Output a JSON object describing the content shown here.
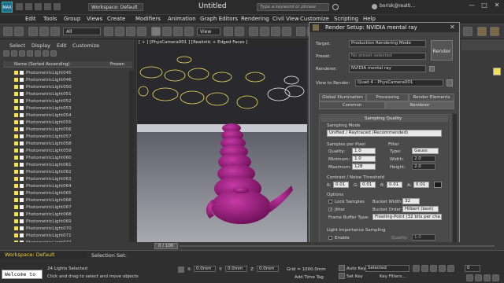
{
  "titlebar": {
    "workspace": "Workspace: Default",
    "title": "Untitled",
    "search_placeholder": "Type a keyword or phrase",
    "user": "borisk@realti..."
  },
  "menu": [
    "Edit",
    "Tools",
    "Group",
    "Views",
    "Create",
    "Modifiers",
    "Animation",
    "Graph Editors",
    "Rendering",
    "Civil View",
    "Customize",
    "Scripting",
    "Help"
  ],
  "toolbar": {
    "selection_filter": "All",
    "view_dropdown": "View"
  },
  "left_panel": {
    "tabs": [
      "Select",
      "Display",
      "Edit",
      "Customize"
    ],
    "header_name": "Name (Sorted Ascending)",
    "header_frozen": "Frozen",
    "items": [
      "PhotometricLight045",
      "PhotometricLight046",
      "PhotometricLight050",
      "PhotometricLight051",
      "PhotometricLight052",
      "PhotometricLight053",
      "PhotometricLight054",
      "PhotometricLight055",
      "PhotometricLight056",
      "PhotometricLight057",
      "PhotometricLight058",
      "PhotometricLight059",
      "PhotometricLight060",
      "PhotometricLight061",
      "PhotometricLight062",
      "PhotometricLight063",
      "PhotometricLight064",
      "PhotometricLight065",
      "PhotometricLight066",
      "PhotometricLight067",
      "PhotometricLight068",
      "PhotometricLight069",
      "PhotometricLight070",
      "PhotometricLight071",
      "PhotometricLight072"
    ]
  },
  "viewport": {
    "label": "[ + ] [PhysCamera001 ] [Realistic + Edged Faces ]"
  },
  "render_setup": {
    "title": "Render Setup: NVIDIA mental ray",
    "target_label": "Target:",
    "target_value": "Production Rendering Mode",
    "preset_label": "Preset:",
    "preset_value": "No preset selected",
    "renderer_label": "Renderer:",
    "renderer_value": "NVIDIA mental ray",
    "render_button": "Render",
    "view_label": "View to Render:",
    "view_value": "Quad 4 - PhysCamera001",
    "tabs_row1": [
      "Global Illumination",
      "Processing",
      "Render Elements"
    ],
    "tabs_row2": [
      "Common",
      "Renderer"
    ],
    "rollout": "Sampling Quality",
    "sampling_mode_label": "Sampling Mode",
    "sampling_mode_value": "Unified / Raytraced (Recommended)",
    "samples_label": "Samples per Pixel",
    "quality_label": "Quality:",
    "quality_value": "1.0",
    "minimum_label": "Minimum:",
    "minimum_value": "1.0",
    "maximum_label": "Maximum:",
    "maximum_value": "128",
    "filter_label": "Filter",
    "type_label": "Type:",
    "type_value": "Gauss",
    "width_label": "Width:",
    "width_value": "2.0",
    "height_label": "Height:",
    "height_value": "2.0",
    "contrast_label": "Contrast / Noise Threshold",
    "contrast_values": [
      "0.01",
      "0.01",
      "0.01",
      "0.01"
    ],
    "contrast_letters": [
      "R:",
      "G:",
      "B:",
      "A:"
    ],
    "options_label": "Options",
    "lock_samples": "Lock Samples",
    "jitter": "Jitter",
    "bucket_width_label": "Bucket Width:",
    "bucket_width_value": "32",
    "bucket_order_label": "Bucket Order:",
    "bucket_order_value": "Hilbert (best)",
    "frame_buffer_label": "Frame Buffer Type:",
    "frame_buffer_value": "Floating-Point (32 bits per cha",
    "light_importance": "Light Importance Sampling",
    "enable_label": "Enable",
    "quality2_label": "Quality:",
    "quality2_value": "1.0"
  },
  "timeline": {
    "frame": "0 / 100"
  },
  "bottom": {
    "workspace": "Workspace: Default",
    "selection_set": "Selection Set:",
    "welcome": "Welcome to",
    "status1": "24 Lights Selected",
    "status2": "Click and drag to select and move objects",
    "x_label": "X:",
    "x_value": "0.0mm",
    "y_label": "Y:",
    "y_value": "0.0mm",
    "z_label": "Z:",
    "z_value": "0.0mm",
    "grid": "Grid = 1000.0mm",
    "add_time_tag": "Add Time Tag",
    "auto_key": "Auto Key",
    "selected": "Selected",
    "set_key": "Set Key",
    "key_filters": "Key Filters...",
    "frame_value": "0"
  },
  "colors": {
    "teapot": "#9a1a7a",
    "selected_light": "#f0e060",
    "title_bg": "#2b2b2b"
  }
}
